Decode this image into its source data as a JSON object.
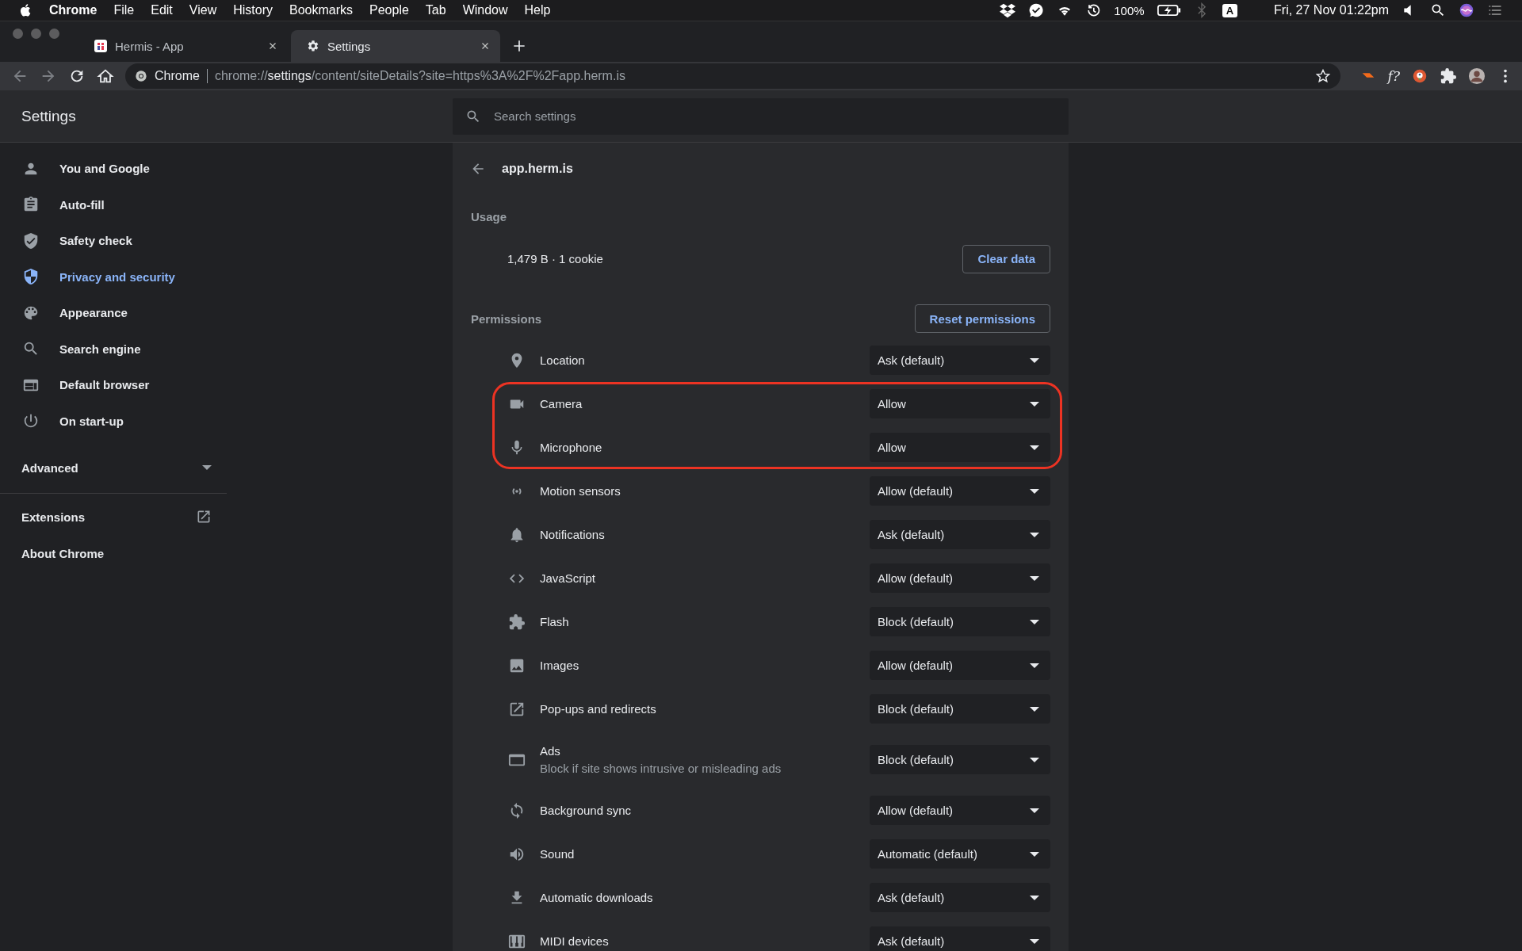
{
  "menubar": {
    "app": "Chrome",
    "items": [
      "File",
      "Edit",
      "View",
      "History",
      "Bookmarks",
      "People",
      "Tab",
      "Window",
      "Help"
    ],
    "battery": "100%",
    "input_source": "A",
    "clock": "Fri, 27 Nov 01:22pm"
  },
  "tabs": [
    {
      "title": "Hermis - App",
      "selected": false
    },
    {
      "title": "Settings",
      "selected": true
    }
  ],
  "toolbar": {
    "site_chip": "Chrome",
    "url": "chrome://**settings**/content/siteDetails?site=https%3A%2F%2Fapp.herm.is",
    "extension_label": "f?"
  },
  "header": {
    "title": "Settings",
    "search_placeholder": "Search settings"
  },
  "sidebar": {
    "items": [
      {
        "label": "You and Google",
        "selected": false
      },
      {
        "label": "Auto-fill",
        "selected": false
      },
      {
        "label": "Safety check",
        "selected": false
      },
      {
        "label": "Privacy and security",
        "selected": true
      },
      {
        "label": "Appearance",
        "selected": false
      },
      {
        "label": "Search engine",
        "selected": false
      },
      {
        "label": "Default browser",
        "selected": false
      },
      {
        "label": "On start-up",
        "selected": false
      }
    ],
    "advanced": {
      "label": "Advanced",
      "expanded": false
    },
    "links": [
      {
        "label": "Extensions",
        "external": true
      },
      {
        "label": "About Chrome",
        "external": false
      }
    ]
  },
  "site": {
    "title": "app.herm.is",
    "usage": {
      "label": "Usage",
      "summary": "1,479 B · 1 cookie",
      "button": "Clear data"
    },
    "permissions": {
      "label": "Permissions",
      "button": "Reset permissions",
      "rows": [
        {
          "label": "Location",
          "value": "Ask (default)",
          "highlighted": false
        },
        {
          "label": "Camera",
          "value": "Allow",
          "highlighted": true
        },
        {
          "label": "Microphone",
          "value": "Allow",
          "highlighted": true
        },
        {
          "label": "Motion sensors",
          "value": "Allow (default)",
          "highlighted": false
        },
        {
          "label": "Notifications",
          "value": "Ask (default)",
          "highlighted": false
        },
        {
          "label": "JavaScript",
          "value": "Allow (default)",
          "highlighted": false
        },
        {
          "label": "Flash",
          "value": "Block (default)",
          "highlighted": false
        },
        {
          "label": "Images",
          "value": "Allow (default)",
          "highlighted": false
        },
        {
          "label": "Pop-ups and redirects",
          "value": "Block (default)",
          "highlighted": false
        },
        {
          "label": "Ads",
          "description": "Block if site shows intrusive or misleading ads",
          "value": "Block (default)",
          "highlighted": false
        },
        {
          "label": "Background sync",
          "value": "Allow (default)",
          "highlighted": false
        },
        {
          "label": "Sound",
          "value": "Automatic (default)",
          "highlighted": false
        },
        {
          "label": "Automatic downloads",
          "value": "Ask (default)",
          "highlighted": false
        },
        {
          "label": "MIDI devices",
          "value": "Ask (default)",
          "highlighted": false
        }
      ]
    }
  }
}
